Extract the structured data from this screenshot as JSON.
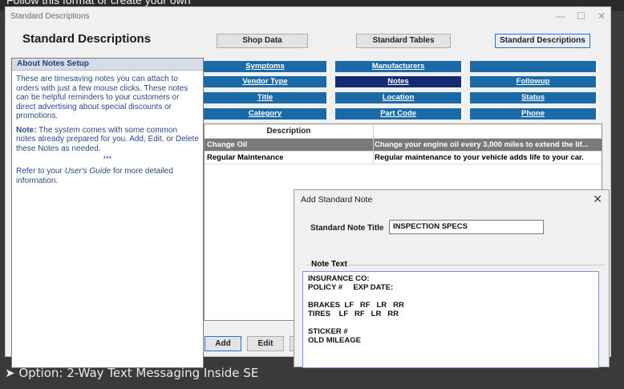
{
  "top_banner_text": "Follow this format or create your own",
  "window": {
    "title": "Standard Descriptions",
    "heading": "Standard Descriptions",
    "top_buttons": [
      "Shop Data",
      "Standard Tables",
      "Standard Descriptions"
    ],
    "nav_buttons": [
      [
        "Symptoms",
        "Manufacturers",
        ""
      ],
      [
        "Vendor Type",
        "Notes",
        "Followup"
      ],
      [
        "Title",
        "Location",
        "Status"
      ],
      [
        "Category",
        "Part Code",
        "Phone"
      ]
    ],
    "selected_nav": "Notes"
  },
  "left_panel": {
    "heading": "About Notes Setup",
    "para1": "These are timesaving notes you can attach to orders with just a few mouse clicks. These notes can be helpful reminders to your customers or direct advertising about special discounts or promotions.",
    "note_label": "Note:",
    "para2": "The system comes with some common notes already prepared for you. Add, Edit, or Delete these Notes as needed.",
    "stars": "***",
    "para3_pre": "Refer to your ",
    "para3_italic": "User's Guide",
    "para3_post": " for more detailed information."
  },
  "grid": {
    "header": "Description",
    "rows": [
      {
        "name": "Change Oil",
        "desc": "Change your engine oil every 3,000 miles to extend the lif..."
      },
      {
        "name": "Regular Maintenance",
        "desc": "Regular maintenance to your vehicle adds life to your car."
      }
    ]
  },
  "bottom_buttons": [
    "Add",
    "Edit"
  ],
  "caption": "➤ Option: 2-Way Text Messaging Inside SE",
  "dialog": {
    "title": "Add Standard Note",
    "title_label": "Standard Note Title",
    "title_value": "INSPECTION SPECS",
    "text_label": "Note Text",
    "note_text": "INSURANCE CO:\nPOLICY #     EXP DATE:\n\nBRAKES  LF   RF   LR   RR\nTIRES    LF   RF   LR   RR\n\nSTICKER #\nOLD MILEAGE"
  }
}
